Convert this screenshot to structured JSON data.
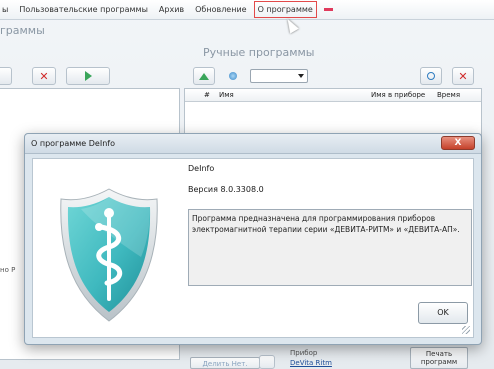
{
  "menubar": {
    "items": [
      "ы",
      "Пользовательские программы",
      "Архив",
      "Обновление",
      "О программе"
    ]
  },
  "left_panel": {
    "title": "граммы",
    "side_fragment": "но Р"
  },
  "right_panel": {
    "title": "Ручные программы",
    "columns": [
      "#",
      "Имя",
      "Имя в приборе",
      "Время"
    ]
  },
  "bottom": {
    "device_label": "Прибор",
    "device_link": "DeVita Ritm",
    "blur_button": "Делить Нет.",
    "print_button_line1": "Печать",
    "print_button_line2": "программ"
  },
  "dialog": {
    "title": "О программе DeInfo",
    "close_label": "X",
    "app_name": "DeInfo",
    "version": "Версия 8.0.3308.0",
    "description": "Программа предназначена для программирования приборов электромагнитной терапии серии «ДЕВИТА-РИТМ» и «ДЕВИТА-АП».",
    "ok_label": "OK"
  },
  "icons": {
    "logo": "shield-caduceus-icon",
    "delete": "close-x-icon",
    "add": "arrow-right-icon",
    "up": "arrow-up-icon",
    "search": "search-icon"
  },
  "colors": {
    "shield_teal": "#3fb9bf",
    "shield_border": "#d8dde1",
    "delete_red": "#d12b2b",
    "add_green": "#3aa55a",
    "menu_highlight": "#e24a4a",
    "close_button": "#c5412a"
  }
}
